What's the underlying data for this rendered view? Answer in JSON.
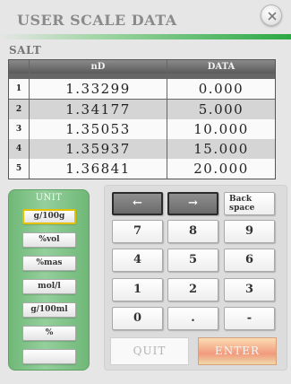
{
  "header": {
    "title": "USER SCALE DATA",
    "section": "SALT"
  },
  "table": {
    "columns": [
      "nD",
      "DATA"
    ],
    "rows": [
      {
        "index": "1",
        "nd": "1.33299",
        "data": "0.000"
      },
      {
        "index": "2",
        "nd": "1.34177",
        "data": "5.000"
      },
      {
        "index": "3",
        "nd": "1.35053",
        "data": "10.000"
      },
      {
        "index": "4",
        "nd": "1.35937",
        "data": "15.000"
      },
      {
        "index": "5",
        "nd": "1.36841",
        "data": "20.000"
      }
    ]
  },
  "unit": {
    "label": "UNIT",
    "options": [
      "g/100g",
      "%vol",
      "%mas",
      "mol/l",
      "g/100ml",
      "%",
      ""
    ],
    "selected": "g/100g"
  },
  "keypad": {
    "left_arrow": "←",
    "right_arrow": "→",
    "backspace": "Back space",
    "keys": [
      "7",
      "8",
      "9",
      "4",
      "5",
      "6",
      "1",
      "2",
      "3",
      "0",
      ".",
      "-"
    ]
  },
  "actions": {
    "quit": "QUIT",
    "enter": "ENTER"
  },
  "colors": {
    "accent_green": "#2aa844",
    "selected_border": "#e3c000",
    "enter_orange": "#f19a7c"
  }
}
